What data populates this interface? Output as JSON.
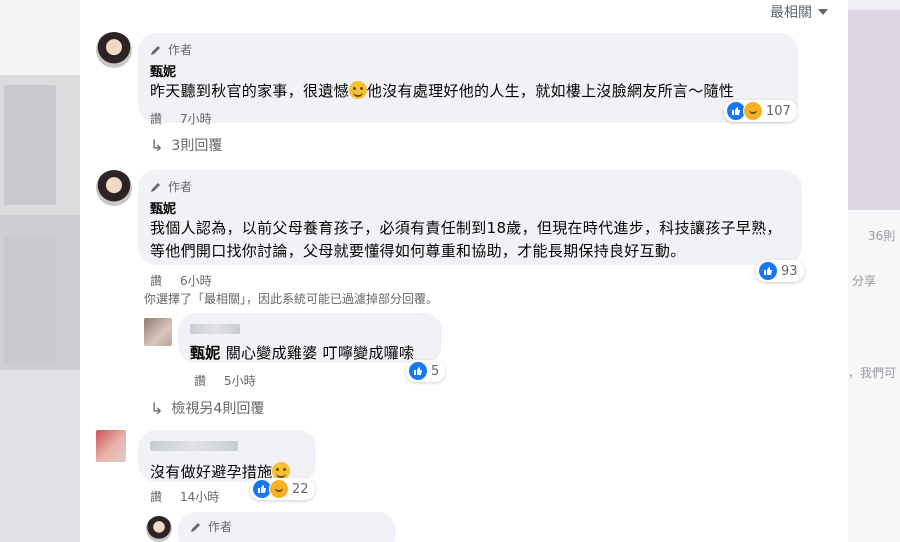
{
  "sort": {
    "label": "最相關"
  },
  "background": {
    "right_count": "36則",
    "right_share": "分享",
    "right_misc": "，我們可"
  },
  "comments": [
    {
      "author_badge": "作者",
      "name": "甄妮",
      "text_a": "昨天聽到秋官的家事，很遺憾",
      "text_b": "他沒有處理好他的人生，就如樓上沒臉網友所言～隨性",
      "action": "讚",
      "time": "7小時",
      "reactions": "107",
      "replies_link": "3則回覆"
    },
    {
      "author_badge": "作者",
      "name": "甄妮",
      "text": "我個人認為，以前父母養育孩子，必須有責任制到18歲，但現在時代進步，科技讓孩子早熟，等他們開口找你討論，父母就要懂得如何尊重和協助，才能長期保持良好互動。",
      "action": "讚",
      "time": "6小時",
      "reactions": "93",
      "notice": "你選擇了「最相關」，因此系統可能已過濾掉部分回覆。"
    },
    {
      "mention": "甄妮",
      "text": "關心變成雞婆 叮嚀變成囉嗦",
      "action": "讚",
      "time": "5小時",
      "reactions": "5",
      "more_replies": "檢視另4則回覆"
    },
    {
      "text": "沒有做好避孕措施",
      "action": "讚",
      "time": "14小時",
      "reactions": "22"
    },
    {
      "author_badge": "作者"
    }
  ],
  "colors": {
    "like": "#1877f2",
    "bubble": "#f0f2f5",
    "meta": "#65676b"
  }
}
